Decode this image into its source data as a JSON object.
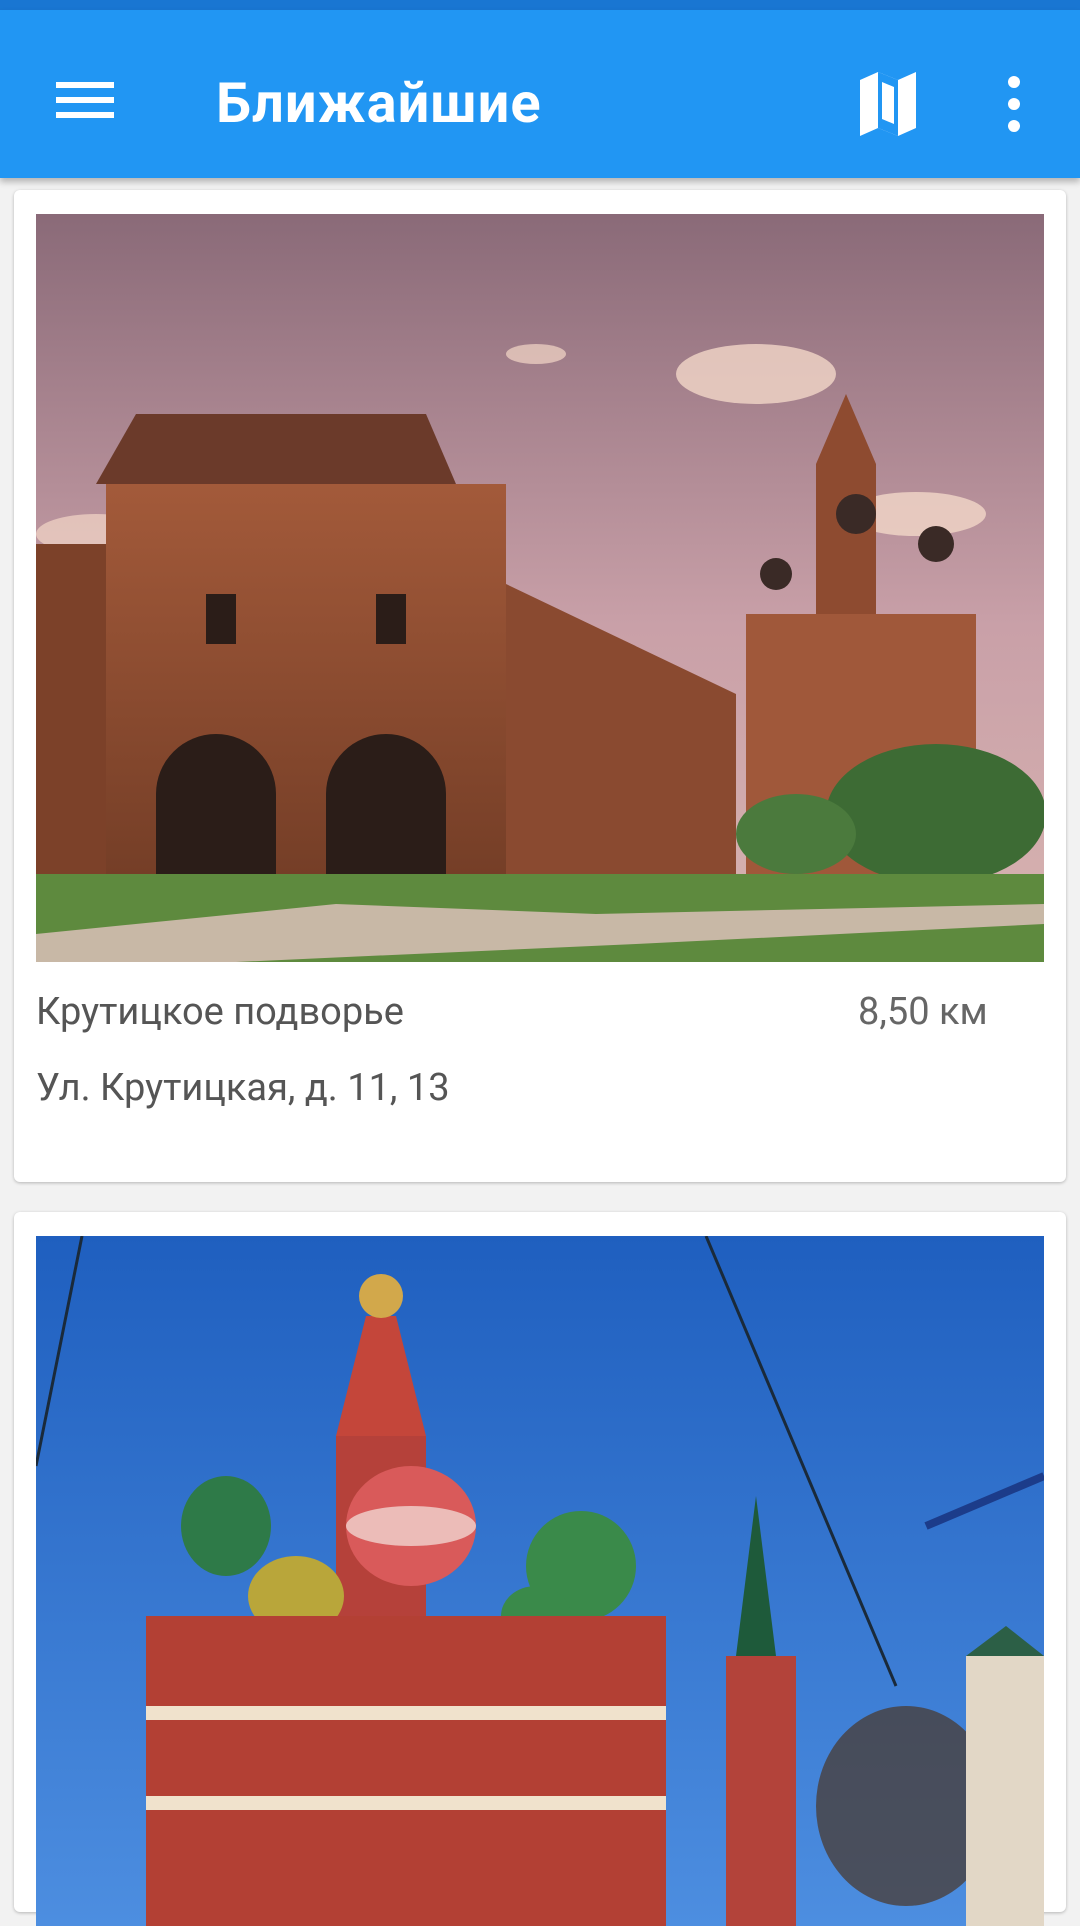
{
  "app": {
    "title": "Ближайшие",
    "icons": {
      "menu": "hamburger-menu-icon",
      "map": "map-icon",
      "more": "more-vert-icon"
    },
    "colors": {
      "app_bar": "#2196f3",
      "status_bar": "#1976d2"
    }
  },
  "places": [
    {
      "name": "Крутицкое подворье",
      "distance": "8,50  км",
      "address": "Ул. Крутицкая, д. 11, 13"
    },
    {
      "name": "",
      "distance": "",
      "address": ""
    }
  ]
}
